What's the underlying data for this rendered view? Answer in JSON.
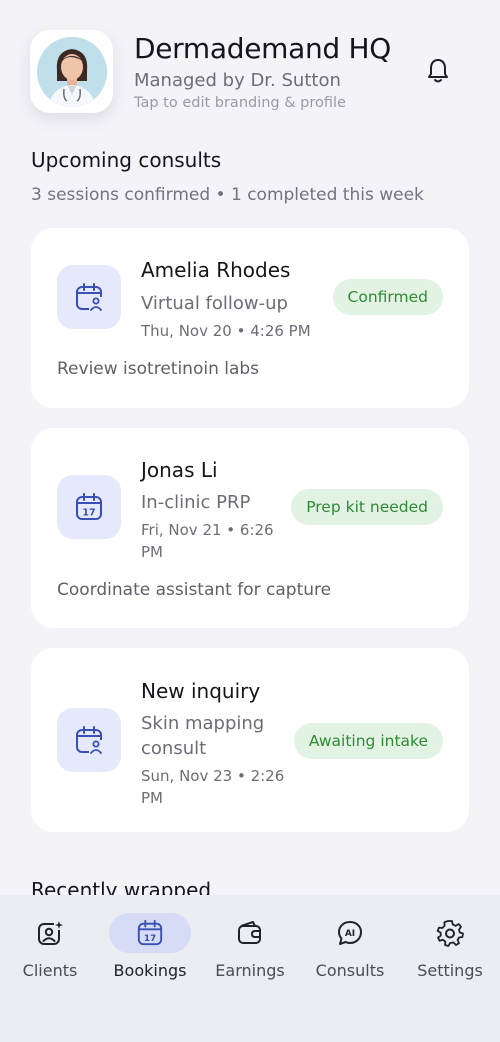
{
  "header": {
    "title": "Dermademand HQ",
    "subtitle": "Managed by Dr. Sutton",
    "hint": "Tap to edit branding & profile"
  },
  "upcoming": {
    "title": "Upcoming consults",
    "summary": "3 sessions confirmed • 1 completed this week"
  },
  "consults": [
    {
      "name": "Amelia Rhodes",
      "type": "Virtual follow-up",
      "time": "Thu, Nov 20 • 4:26 PM",
      "status": "Confirmed",
      "note": "Review isotretinoin labs",
      "icon": "calendar-user-icon"
    },
    {
      "name": "Jonas Li",
      "type": "In-clinic PRP",
      "time": "Fri, Nov 21 • 6:26 PM",
      "status": "Prep kit needed",
      "note": "Coordinate assistant for capture",
      "icon": "calendar-17-icon"
    },
    {
      "name": "New inquiry",
      "type": "Skin mapping consult",
      "time": "Sun, Nov 23 • 2:26 PM",
      "status": "Awaiting intake",
      "note": "",
      "icon": "calendar-user-icon"
    }
  ],
  "recent": {
    "title": "Recently wrapped"
  },
  "tabs": [
    {
      "label": "Clients",
      "icon": "clients-icon",
      "active": false
    },
    {
      "label": "Bookings",
      "icon": "calendar-17-icon",
      "active": true
    },
    {
      "label": "Earnings",
      "icon": "wallet-icon",
      "active": false
    },
    {
      "label": "Consults",
      "icon": "ai-chat-icon",
      "active": false
    },
    {
      "label": "Settings",
      "icon": "gear-icon",
      "active": false
    }
  ],
  "colors": {
    "background": "#f3f3f8",
    "accent": "#3a4fb4",
    "icon_bg": "#e6e9fb",
    "badge_bg": "#e3f3e3",
    "badge_text": "#2f8a35"
  }
}
